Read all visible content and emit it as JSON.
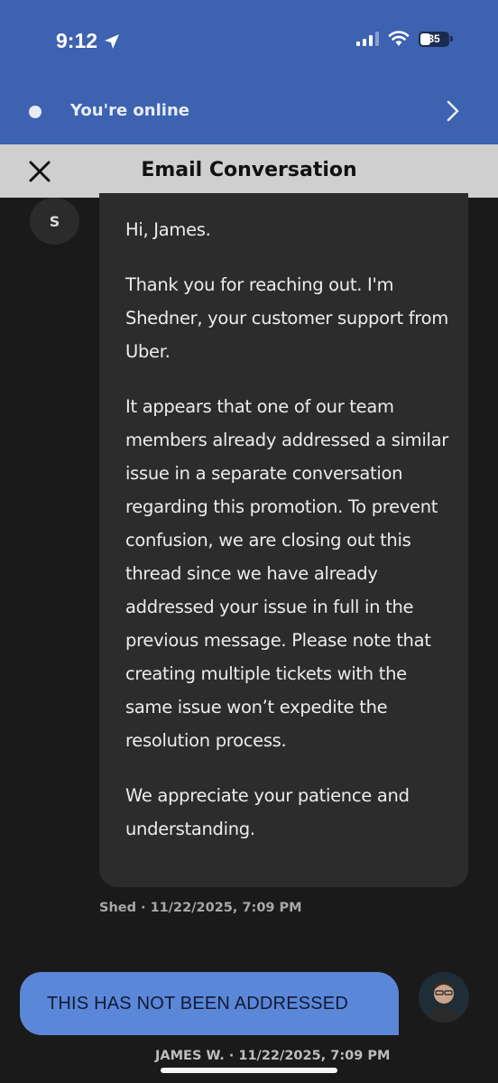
{
  "status_bar": {
    "time": "9:12",
    "battery": "35",
    "icons": [
      "location-arrow-icon",
      "cellular-signal-icon",
      "wifi-icon",
      "battery-icon"
    ]
  },
  "online_banner": {
    "label": "You're online",
    "icon_right": "chevron-right-icon"
  },
  "header": {
    "title": "Email Conversation",
    "close_icon": "close-icon"
  },
  "conversation": {
    "support_message": {
      "avatar_initial": "S",
      "paragraphs": [
        "Hi, James.",
        "Thank you for reaching out. I'm Shedner, your customer support from Uber.",
        "It appears that one of our team members already addressed a similar issue in a separate conversation regarding this promotion. To prevent confusion, we are closing out this thread since we have already addressed your issue in full in the previous message. Please note that creating multiple tickets with the same issue won’t expedite the resolution process.",
        "We appreciate your patience and understanding."
      ],
      "meta": "Shed · 11/22/2025, 7:09 PM"
    },
    "user_message": {
      "text": "THIS HAS NOT BEEN ADDRESSED",
      "meta": "JAMES W. · 11/22/2025, 7:09 PM"
    }
  },
  "colors": {
    "top_bar": "#3d62b0",
    "header_bg": "#cfcfcf",
    "background": "#1a1a1a",
    "support_bubble": "#2c2c2c",
    "user_bubble": "#5b87d8"
  }
}
